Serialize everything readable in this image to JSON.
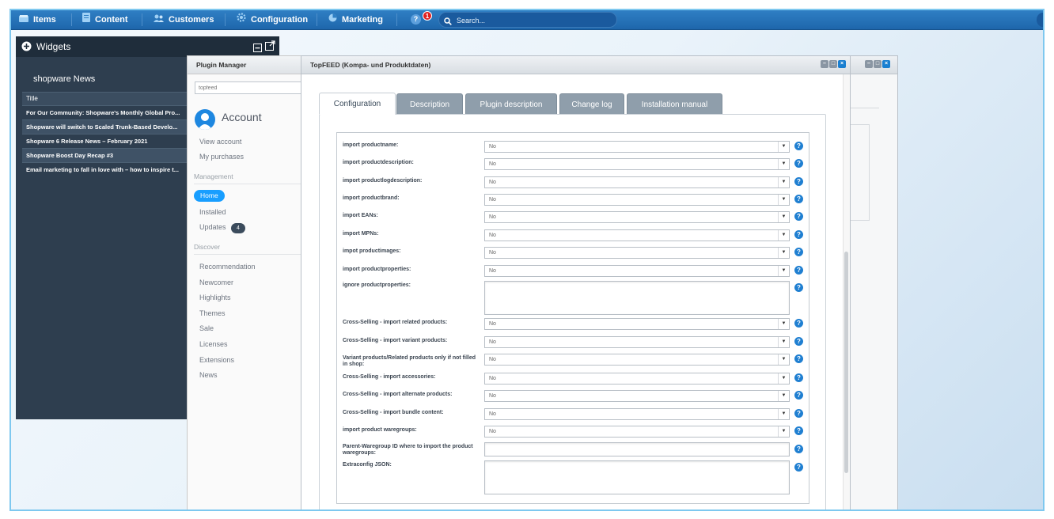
{
  "nav": {
    "items": [
      {
        "label": "Items",
        "icon": "items-icon"
      },
      {
        "label": "Content",
        "icon": "content-icon"
      },
      {
        "label": "Customers",
        "icon": "customers-icon"
      },
      {
        "label": "Configuration",
        "icon": "configuration-icon"
      },
      {
        "label": "Marketing",
        "icon": "marketing-icon"
      }
    ],
    "notification_count": "1",
    "search_placeholder": "Search..."
  },
  "widgets": {
    "title": "Widgets",
    "news_title": "shopware News",
    "table_header": "Title",
    "news": [
      "For Our Community: Shopware's Monthly Global Pro...",
      "Shopware will switch to Scaled Trunk-Based Develo...",
      "Shopware 6 Release News – February 2021",
      "Shopware Boost Day Recap #3",
      "Email marketing to fall in love with – how to inspire t..."
    ]
  },
  "plugin_manager": {
    "title": "Plugin Manager",
    "search_value": "topfeed",
    "account_title": "Account",
    "account_links": [
      "View account",
      "My purchases"
    ],
    "management_label": "Management",
    "management_items": [
      "Home",
      "Installed",
      "Updates"
    ],
    "updates_count": "4",
    "discover_label": "Discover",
    "discover_items": [
      "Recommendation",
      "Newcomer",
      "Highlights",
      "Themes",
      "Sale",
      "Licenses",
      "Extensions",
      "News"
    ]
  },
  "main_window": {
    "title": "TopFEED (Kompa- und Produktdaten)",
    "tabs": [
      "Configuration",
      "Description",
      "Plugin description",
      "Change log",
      "Installation manual"
    ],
    "active_tab": "Configuration"
  },
  "form": {
    "fields": [
      {
        "label": "import productname:",
        "type": "select",
        "value": "No"
      },
      {
        "label": "import productdescription:",
        "type": "select",
        "value": "No"
      },
      {
        "label": "import productlogdescription:",
        "type": "select",
        "value": "No"
      },
      {
        "label": "import productbrand:",
        "type": "select",
        "value": "No"
      },
      {
        "label": "import EANs:",
        "type": "select",
        "value": "No"
      },
      {
        "label": "import MPNs:",
        "type": "select",
        "value": "No"
      },
      {
        "label": "impot productimages:",
        "type": "select",
        "value": "No"
      },
      {
        "label": "import productproperties:",
        "type": "select",
        "value": "No"
      },
      {
        "label": "ignore productproperties:",
        "type": "textarea",
        "value": ""
      },
      {
        "label": "Cross-Selling - import related products:",
        "type": "select",
        "value": "No"
      },
      {
        "label": "Cross-Selling - import variant products:",
        "type": "select",
        "value": "No"
      },
      {
        "label": "Variant products/Related products only if not filled in shop:",
        "type": "select",
        "value": "No"
      },
      {
        "label": "Cross-Selling - import accessories:",
        "type": "select",
        "value": "No"
      },
      {
        "label": "Cross-Selling - import alternate products:",
        "type": "select",
        "value": "No"
      },
      {
        "label": "Cross-Selling - import bundle content:",
        "type": "select",
        "value": "No"
      },
      {
        "label": "import product waregroups:",
        "type": "select",
        "value": "No"
      },
      {
        "label": "Parent-Waregroup ID where to import the product waregroups:",
        "type": "text",
        "value": ""
      },
      {
        "label": "Extraconfig JSON:",
        "type": "textarea",
        "value": ""
      }
    ]
  }
}
